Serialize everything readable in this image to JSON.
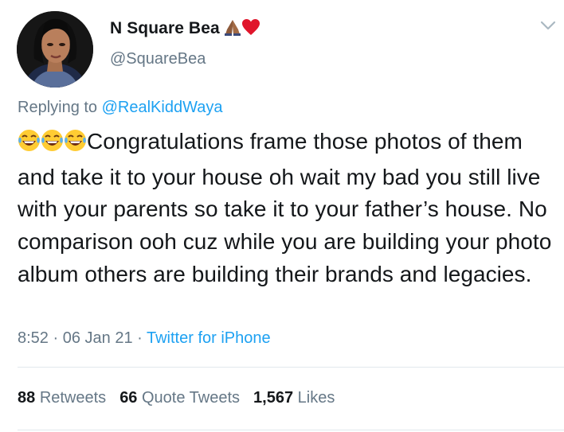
{
  "author": {
    "display_name": "N Square Bea",
    "handle": "@SquareBea",
    "name_emojis": [
      "folded-hands-icon",
      "red-heart-icon"
    ]
  },
  "reply": {
    "prefix": "Replying to ",
    "mention": "@RealKiddWaya"
  },
  "tweet": {
    "leading_emojis": [
      "tears-of-joy-icon",
      "tears-of-joy-icon",
      "tears-of-joy-icon"
    ],
    "text": "Congratulations frame those photos  of them and take it to your house oh wait my bad you still live with your parents so take it to your father’s house. No comparison ooh cuz while you are building your photo album others are building their brands and legacies."
  },
  "meta": {
    "time": "8:52",
    "separator": " · ",
    "date": "06 Jan 21",
    "source": "Twitter for iPhone"
  },
  "stats": {
    "retweets_count": "88",
    "retweets_label": "Retweets",
    "quotes_count": "66",
    "quotes_label": "Quote Tweets",
    "likes_count": "1,567",
    "likes_label": "Likes"
  },
  "colors": {
    "text": "#14171a",
    "secondary": "#657786",
    "link": "#1da1f2",
    "divider": "#e1e8ed"
  }
}
